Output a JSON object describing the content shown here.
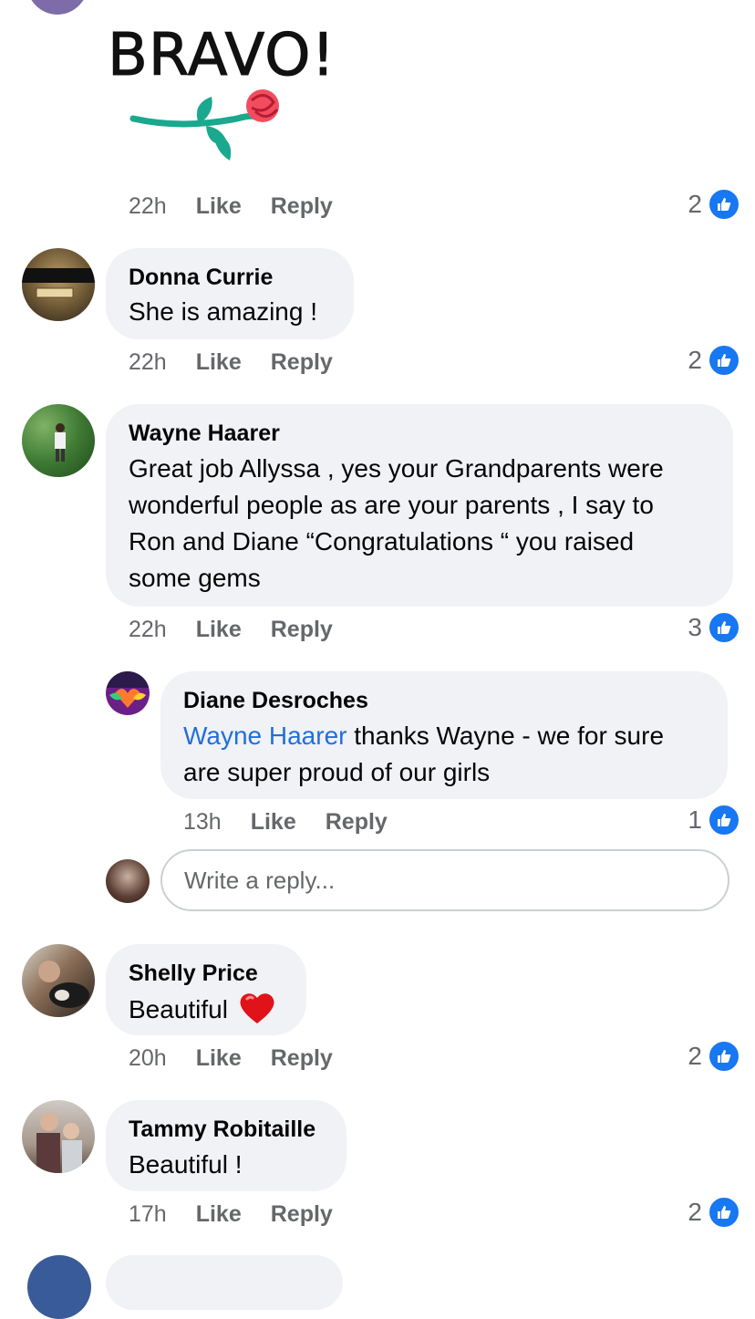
{
  "sticker": {
    "text": "BRAVO!"
  },
  "comments": [
    {
      "time": "22h",
      "like": "Like",
      "reply": "Reply",
      "count": "2"
    },
    {
      "name": "Donna Currie",
      "text": "She is amazing !",
      "time": "22h",
      "like": "Like",
      "reply": "Reply",
      "count": "2"
    },
    {
      "name": "Wayne Haarer",
      "lines": [
        "Great job Allyssa , yes your Grandparents were",
        "wonderful people as are your parents , I say to",
        "Ron and Diane “Congratulations “ you raised",
        "some gems"
      ],
      "time": "22h",
      "like": "Like",
      "reply": "Reply",
      "count": "3"
    },
    {
      "name": "Shelly Price",
      "text": "Beautiful",
      "time": "20h",
      "like": "Like",
      "reply": "Reply",
      "count": "2"
    },
    {
      "name": "Tammy Robitaille",
      "text": "Beautiful !",
      "time": "17h",
      "like": "Like",
      "reply": "Reply",
      "count": "2"
    }
  ],
  "reply": {
    "name": "Diane Desroches",
    "mention": "Wayne Haarer",
    "line1_rest": " thanks Wayne - we for sure",
    "line2": "are super proud of our girls",
    "time": "13h",
    "like": "Like",
    "reply": "Reply",
    "count": "1"
  },
  "reply_input": {
    "placeholder": "Write a reply..."
  },
  "colors": {
    "like_blue": "#1877f2",
    "bubble": "#f0f2f5",
    "meta": "#65676b",
    "mention": "#216fdb"
  }
}
